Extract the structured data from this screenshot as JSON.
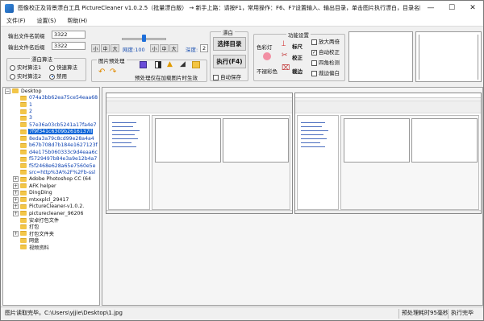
{
  "window": {
    "title": "图像校正及背景漂白工具 PictureCleaner v1.0.2.5（批量漂白版） → 新手上路：请按F1，常用操作：F6、F7设置输入、输出目录，单击图片执行漂白，目录名回车...",
    "minimize": "—",
    "maximize": "☐",
    "close": "✕"
  },
  "menu": [
    "文件(F)",
    "设置(S)",
    "帮助(H)"
  ],
  "toolbar": {
    "prefix_label": "输出文件名前缀",
    "prefix_value": "3322",
    "suffix_label": "输出文件名后缀",
    "suffix_value": "3322",
    "bleach_algo": {
      "title": "漂白算法",
      "options": [
        {
          "label": "实时算法1",
          "selected": false
        },
        {
          "label": "快速算法",
          "selected": false
        },
        {
          "label": "实时算法2",
          "selected": false
        },
        {
          "label": "禁用",
          "selected": true
        }
      ]
    },
    "size_buttons": [
      "小",
      "中",
      "大"
    ],
    "intensity_label": "网度:100",
    "size_buttons2": [
      "小",
      "中",
      "大"
    ],
    "depth_label": "深度:",
    "depth_value": "2",
    "preprocess": {
      "title": "图片预处理",
      "note": "预处理仅在加载图片时生效"
    },
    "bleach_group": {
      "title": "漂白",
      "select_dir": "选择目录",
      "execute": "执行(F4)",
      "auto_save": "自动保存",
      "auto_save_checked": false
    },
    "function_group": {
      "title": "功能设置",
      "color_pick": "色彩灯",
      "ruler": "标尺",
      "correct": "校正",
      "no_color": "不褪彩色",
      "crop": "裁边",
      "zoom_check": "放大两倍",
      "zoom_checked": false,
      "auto_correct": "自动校正",
      "auto_correct_checked": true,
      "four_corner": "四角检测",
      "four_corner_checked": false,
      "crop_offset": "裁边偏白",
      "crop_offset_checked": false
    }
  },
  "tree": {
    "items": [
      {
        "label": "Desktop",
        "level": 0,
        "expander": "−",
        "type": "folder"
      },
      {
        "label": "074a3bb62ea75ce54eaa68",
        "level": 1,
        "type": "folder",
        "link": true
      },
      {
        "label": "1",
        "level": 1,
        "type": "folder",
        "link": true
      },
      {
        "label": "2",
        "level": 1,
        "type": "folder",
        "link": true
      },
      {
        "label": "3",
        "level": 1,
        "type": "folder",
        "link": true
      },
      {
        "label": "57e36a03cb5241a17fa4e7",
        "level": 1,
        "type": "folder",
        "link": true
      },
      {
        "label": "7f9f341c6309b2616137ll",
        "level": 1,
        "type": "folder",
        "selected": true
      },
      {
        "label": "8eda3a79c8cd99e28a4a4",
        "level": 1,
        "type": "folder",
        "link": true
      },
      {
        "label": "b67b708d7b184e1627123f",
        "level": 1,
        "type": "folder",
        "link": true
      },
      {
        "label": "d4e175b060333c9d4eaa6c",
        "level": 1,
        "type": "folder",
        "link": true
      },
      {
        "label": "f5729497b84e3a9e12b4a7",
        "level": 1,
        "type": "folder",
        "link": true
      },
      {
        "label": "f5f2468e628a65e7560e5e",
        "level": 1,
        "type": "folder",
        "link": true
      },
      {
        "label": "src=http%3A%2F%2Fb-ssl",
        "level": 1,
        "type": "folder",
        "link": true
      },
      {
        "label": "Adobe Photoshop CC (64",
        "level": 1,
        "expander": "+",
        "type": "folder"
      },
      {
        "label": "AFK helper",
        "level": 1,
        "expander": "+",
        "type": "folder"
      },
      {
        "label": "DingDing",
        "level": 1,
        "expander": "+",
        "type": "folder"
      },
      {
        "label": "mtxxplcl_29417",
        "level": 1,
        "expander": "+",
        "type": "folder"
      },
      {
        "label": "PictureCleaner-v1.0.2.",
        "level": 1,
        "expander": "+",
        "type": "folder"
      },
      {
        "label": "picturecleaner_96206",
        "level": 1,
        "expander": "+",
        "type": "folder"
      },
      {
        "label": "安卓打包文件",
        "level": 1,
        "type": "folder"
      },
      {
        "label": "打包",
        "level": 1,
        "type": "folder"
      },
      {
        "label": "打包文件夹",
        "level": 1,
        "expander": "+",
        "type": "folder"
      },
      {
        "label": "网盘",
        "level": 1,
        "type": "folder"
      },
      {
        "label": "视频资料",
        "level": 1,
        "type": "folder"
      }
    ]
  },
  "preview": {
    "thumbs": [
      {
        "caption": ""
      },
      {
        "caption": ""
      }
    ]
  },
  "status": {
    "left": "图片读取完毕。C:\\Users\\yjjie\\Desktop\\1.jpg",
    "time": "预处理耗时95毫秒",
    "done": "执行完毕"
  }
}
